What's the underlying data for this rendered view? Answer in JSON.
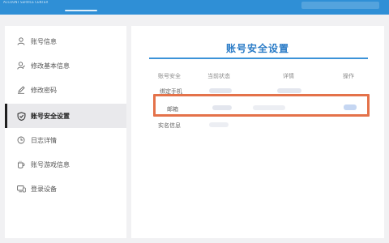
{
  "header": {
    "logo_text": "ACCOUNT SERVICE CENTER",
    "brand_color": "#2f8fd6"
  },
  "sidebar": {
    "items": [
      {
        "label": "账号信息",
        "icon": "user-icon",
        "active": false
      },
      {
        "label": "修改基本信息",
        "icon": "user-edit-icon",
        "active": false
      },
      {
        "label": "修改密码",
        "icon": "pencil-icon",
        "active": false
      },
      {
        "label": "账号安全设置",
        "icon": "shield-icon",
        "active": true
      },
      {
        "label": "日志详情",
        "icon": "clock-icon",
        "active": false
      },
      {
        "label": "账号游戏信息",
        "icon": "mug-icon",
        "active": false
      },
      {
        "label": "登录设备",
        "icon": "devices-icon",
        "active": false
      }
    ]
  },
  "main": {
    "title": "账号安全设置",
    "title_color": "#2b7cc7",
    "table": {
      "columns": [
        "账号安全",
        "当前状态",
        "详情",
        "操作"
      ],
      "rows": [
        {
          "label": "绑定手机"
        },
        {
          "label": "邮箱"
        },
        {
          "label": "实名信息"
        }
      ]
    },
    "highlight_color": "#e4724a"
  }
}
